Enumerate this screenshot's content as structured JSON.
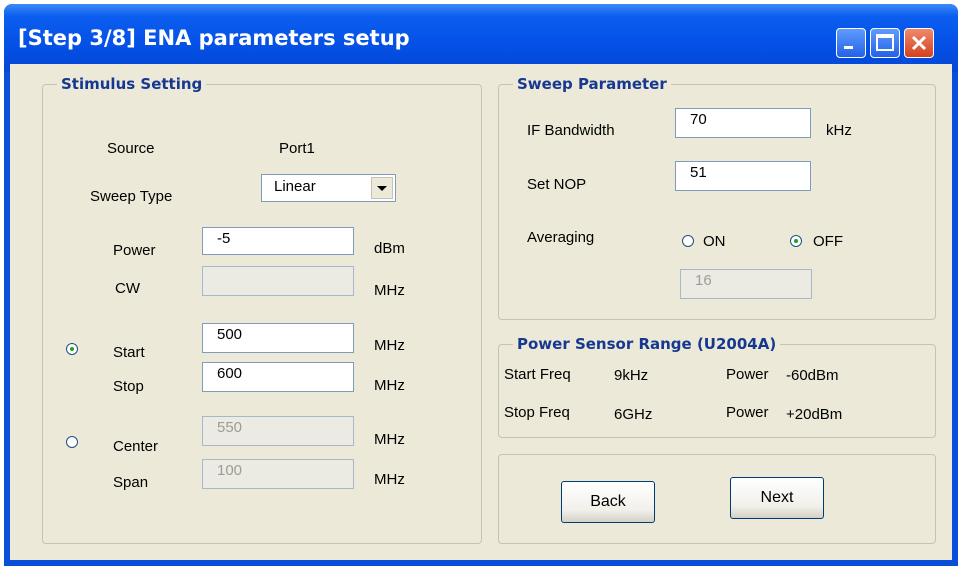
{
  "window": {
    "title": "[Step 3/8] ENA parameters setup"
  },
  "stimulus": {
    "legend": "Stimulus Setting",
    "source_label": "Source",
    "source_value": "Port1",
    "sweep_type_label": "Sweep Type",
    "sweep_type_value": "Linear",
    "power_label": "Power",
    "power_value": "-5",
    "power_unit": "dBm",
    "cw_label": "CW",
    "cw_value": "",
    "cw_unit": "MHz",
    "start_label": "Start",
    "start_value": "500",
    "start_unit": "MHz",
    "stop_label": "Stop",
    "stop_value": "600",
    "stop_unit": "MHz",
    "center_label": "Center",
    "center_value": "550",
    "center_unit": "MHz",
    "span_label": "Span",
    "span_value": "100",
    "span_unit": "MHz",
    "start_stop_selected": true
  },
  "sweep": {
    "legend": "Sweep Parameter",
    "if_bw_label": "IF Bandwidth",
    "if_bw_value": "70",
    "if_bw_unit": "kHz",
    "nop_label": "Set  NOP",
    "nop_value": "51",
    "averaging_label": "Averaging",
    "on_label": "ON",
    "off_label": "OFF",
    "averaging_selected": "OFF",
    "avg_count_value": "16"
  },
  "sensor": {
    "legend": "Power Sensor Range  (U2004A)",
    "start_freq_label": "Start  Freq",
    "start_freq_value": "9kHz",
    "start_power_label": "Power",
    "start_power_value": "-60dBm",
    "stop_freq_label": "Stop  Freq",
    "stop_freq_value": "6GHz",
    "stop_power_label": "Power",
    "stop_power_value": "+20dBm"
  },
  "nav": {
    "back_label": "Back",
    "next_label": "Next"
  },
  "colors": {
    "titlebar": "#0550e6",
    "dialog_bg": "#ece9d8",
    "legend_text": "#163890",
    "close_button": "#d4401e"
  }
}
